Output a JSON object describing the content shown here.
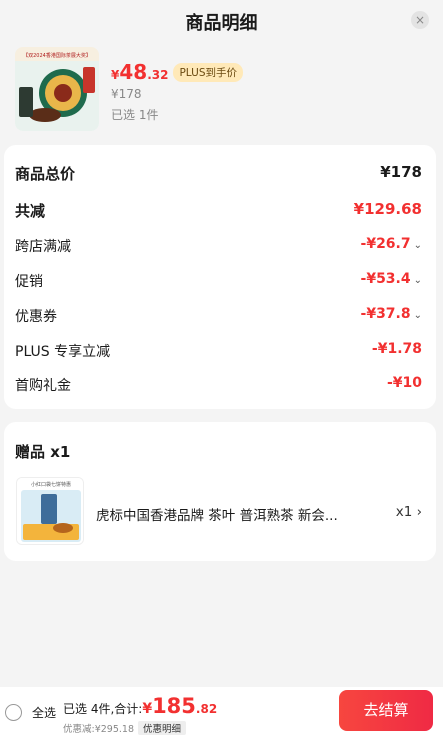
{
  "header": {
    "title": "商品明细",
    "close_symbol": "×"
  },
  "product": {
    "price_symbol": "¥",
    "price_int": "48",
    "price_dec": ".32",
    "plus_tag": "PLUS到手价",
    "orig_price": "¥178",
    "selected_count": "已选 1件",
    "image_banner": "【双2024香港国际茶展大奖】",
    "image_icon": "tea-tin-product-image"
  },
  "summary": {
    "rows": [
      {
        "label": "商品总价",
        "value": "¥178"
      },
      {
        "label": "共减",
        "value": "¥129.68"
      },
      {
        "label": "跨店满减",
        "value": "-¥26.7"
      },
      {
        "label": "促销",
        "value": "-¥53.4"
      },
      {
        "label": "优惠券",
        "value": "-¥37.8"
      },
      {
        "label": "PLUS 专享立减",
        "value": "-¥1.78"
      },
      {
        "label": "首购礼金",
        "value": "-¥10"
      }
    ]
  },
  "gift": {
    "title": "赠品 x1",
    "name": "虎标中国香港品牌 茶叶 普洱熟茶 新会...",
    "qty": "x1",
    "image_label": "小红口袋七饼特惠",
    "image_icon": "tea-gift-box-image"
  },
  "bottom": {
    "select_all": "全选",
    "selected_total_prefix": "已选 4件,合计:",
    "total_symbol": "¥",
    "total_int": "185",
    "total_dec": ".82",
    "discount_text": "优惠减:¥295.18",
    "discount_detail": "优惠明细",
    "checkout": "去结算"
  },
  "colors": {
    "accent": "#f23030",
    "plus_bg": "#ffe9b8",
    "checkout": "#f23a42"
  }
}
